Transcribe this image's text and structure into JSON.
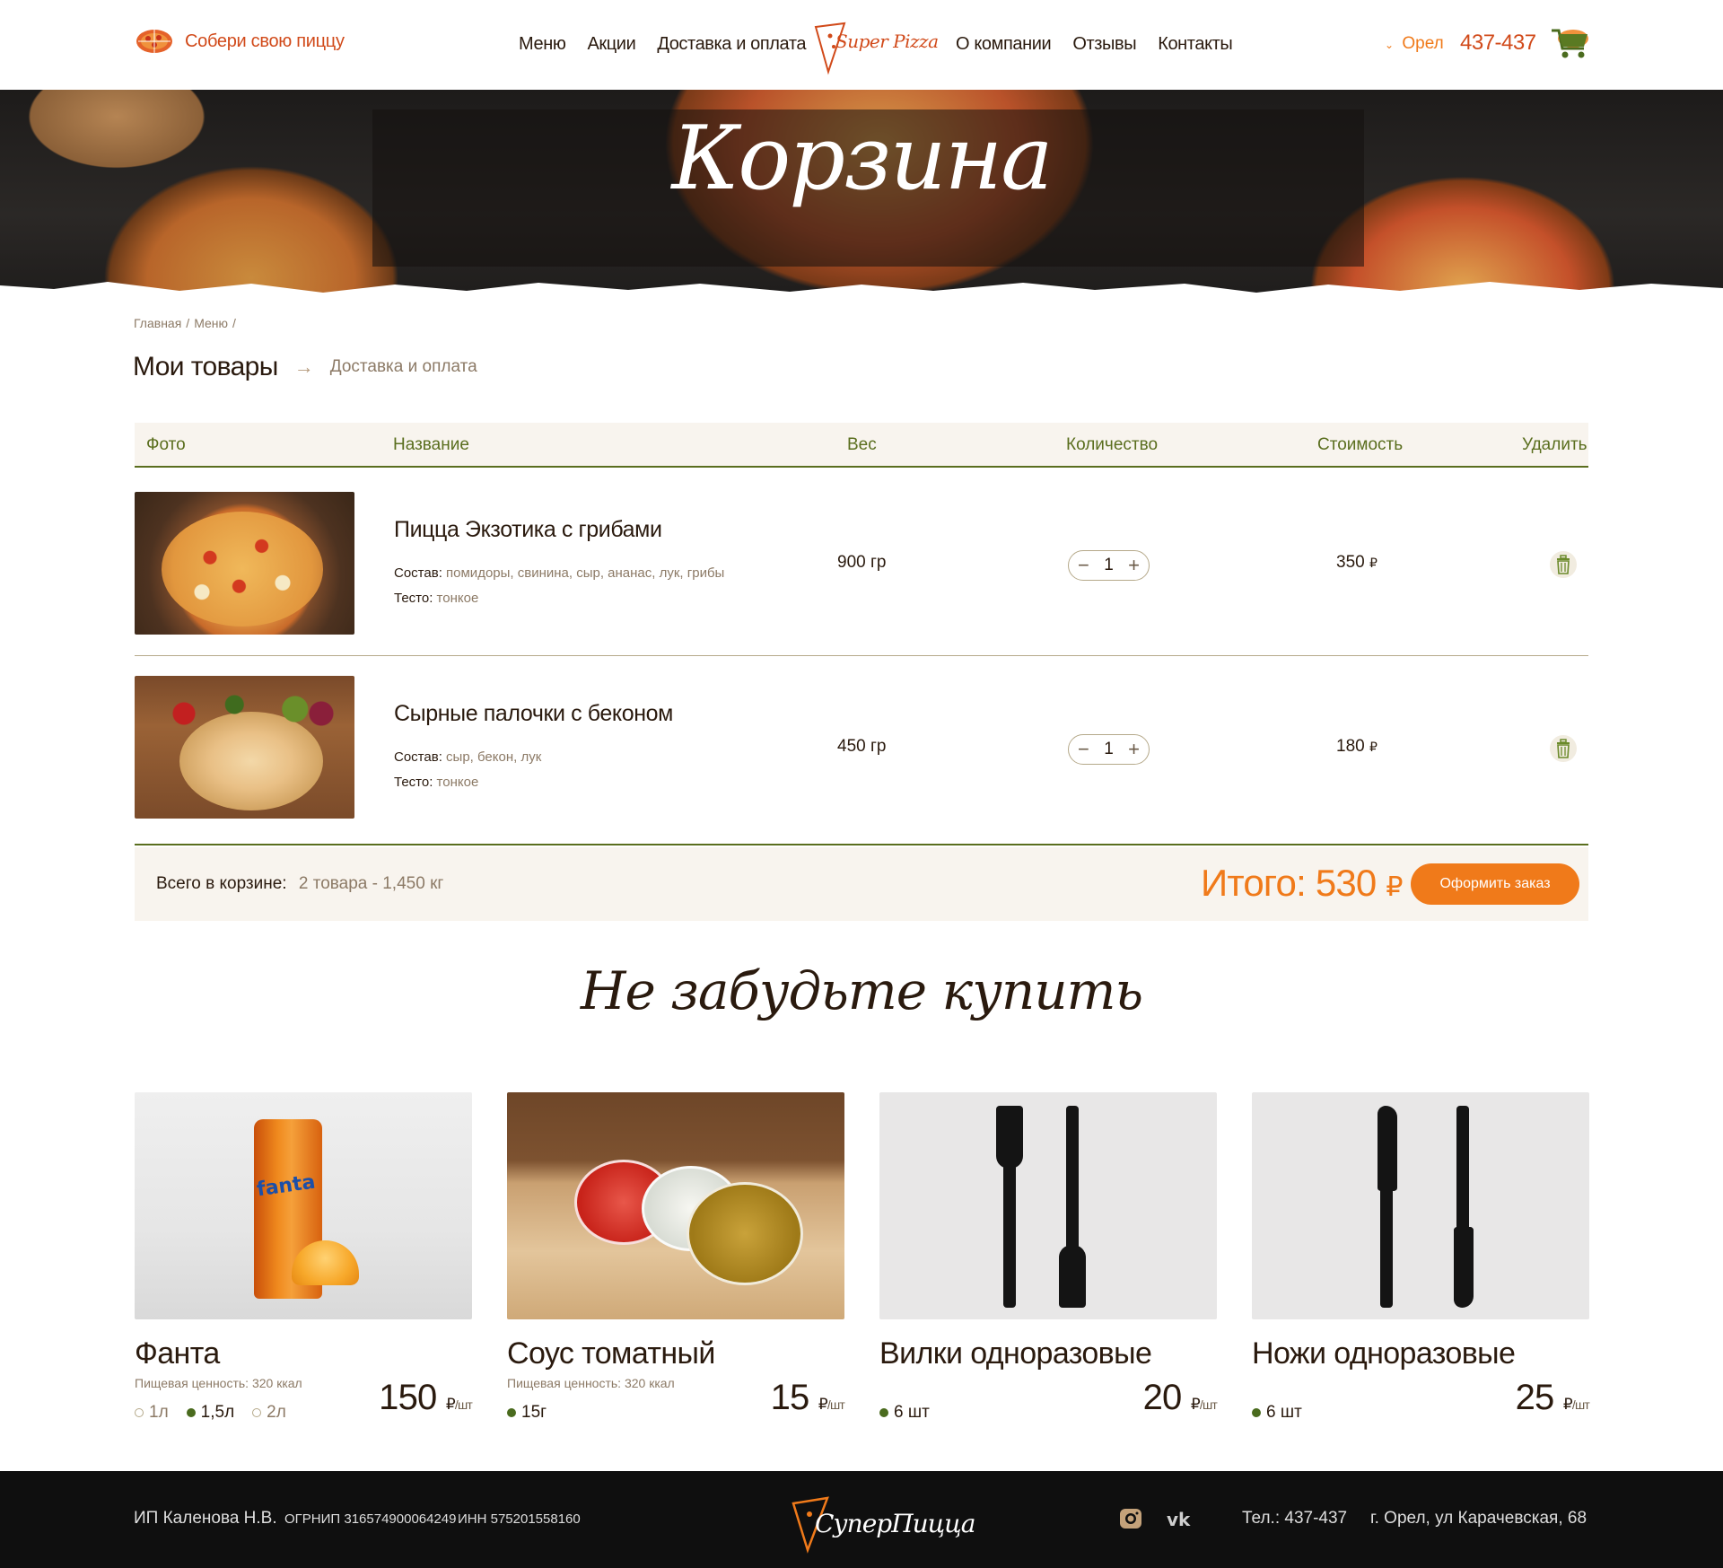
{
  "header": {
    "builder_label": "Собери свою пиццу",
    "nav_left": [
      "Меню",
      "Акции",
      "Доставка и оплата"
    ],
    "nav_right": [
      "О компании",
      "Отзывы",
      "Контакты"
    ],
    "logo_text": "Super Pizza",
    "city": "Орел",
    "phone": "437-437"
  },
  "banner": {
    "title": "Корзина"
  },
  "breadcrumb": [
    "Главная",
    "/",
    "Меню",
    "/"
  ],
  "steps": {
    "active": "Мои товары",
    "next": "Доставка и оплата"
  },
  "table": {
    "headers": {
      "photo": "Фото",
      "name": "Название",
      "weight": "Вес",
      "quantity": "Количество",
      "cost": "Стоимость",
      "delete": "Удалить"
    },
    "items": [
      {
        "title": "Пицца Экзотика с грибами",
        "composition_label": "Состав:",
        "composition": "помидоры, свинина, сыр, ананас, лук, грибы",
        "dough_label": "Тесто:",
        "dough": "тонкое",
        "weight": "900 гр",
        "qty": "1",
        "price": "350",
        "currency": "₽"
      },
      {
        "title": "Сырные палочки с беконом",
        "composition_label": "Состав:",
        "composition": "сыр, бекон, лук",
        "dough_label": "Тесто:",
        "dough": "тонкое",
        "weight": "450 гр",
        "qty": "1",
        "price": "180",
        "currency": "₽"
      }
    ],
    "qty_minus": "−",
    "qty_plus": "+"
  },
  "total": {
    "label": "Всего в корзине:",
    "summary": "2 товара  -  1,450 кг",
    "sum_label": "Итого:",
    "sum": "530",
    "currency": "₽",
    "order_button": "Оформить заказ"
  },
  "suggest": {
    "title": "Не забудьте купить",
    "products": [
      {
        "name": "Фанта",
        "nutrition": "Пищевая ценность:  320 ккал",
        "options": [
          {
            "label": "1л",
            "selected": false
          },
          {
            "label": "1,5л",
            "selected": true
          },
          {
            "label": "2л",
            "selected": false
          }
        ],
        "price": "150",
        "currency": "₽",
        "unit": "/шт"
      },
      {
        "name": "Соус томатный",
        "nutrition": "Пищевая ценность:  320 ккал",
        "options": [
          {
            "label": "15г",
            "selected": true
          }
        ],
        "price": "15",
        "currency": "₽",
        "unit": "/шт"
      },
      {
        "name": "Вилки одноразовые",
        "nutrition": "",
        "options": [
          {
            "label": "6 шт",
            "selected": true
          }
        ],
        "price": "20",
        "currency": "₽",
        "unit": "/шт"
      },
      {
        "name": "Ножи одноразовые",
        "nutrition": "",
        "options": [
          {
            "label": "6 шт",
            "selected": true
          }
        ],
        "price": "25",
        "currency": "₽",
        "unit": "/шт"
      }
    ]
  },
  "footer": {
    "company": "ИП Каленова Н.В.",
    "ogrnip": "ОГРНИП 316574900064249",
    "inn": "ИНН 575201558160",
    "logo_text": "СуперПицца",
    "phone": "Тел.: 437-437",
    "address": "г. Орел, ул Карачевская, 68"
  },
  "colors": {
    "accent": "#f07a1a",
    "brand_red": "#d14a1a",
    "olive": "#5a6e1e",
    "text_dark": "#2a1a0e",
    "muted": "#8c7a66"
  },
  "icons": [
    "pizza-icon",
    "chevron-down-icon",
    "cart-icon",
    "trash-icon",
    "instagram-icon",
    "vk-icon",
    "arrow-right-icon"
  ]
}
